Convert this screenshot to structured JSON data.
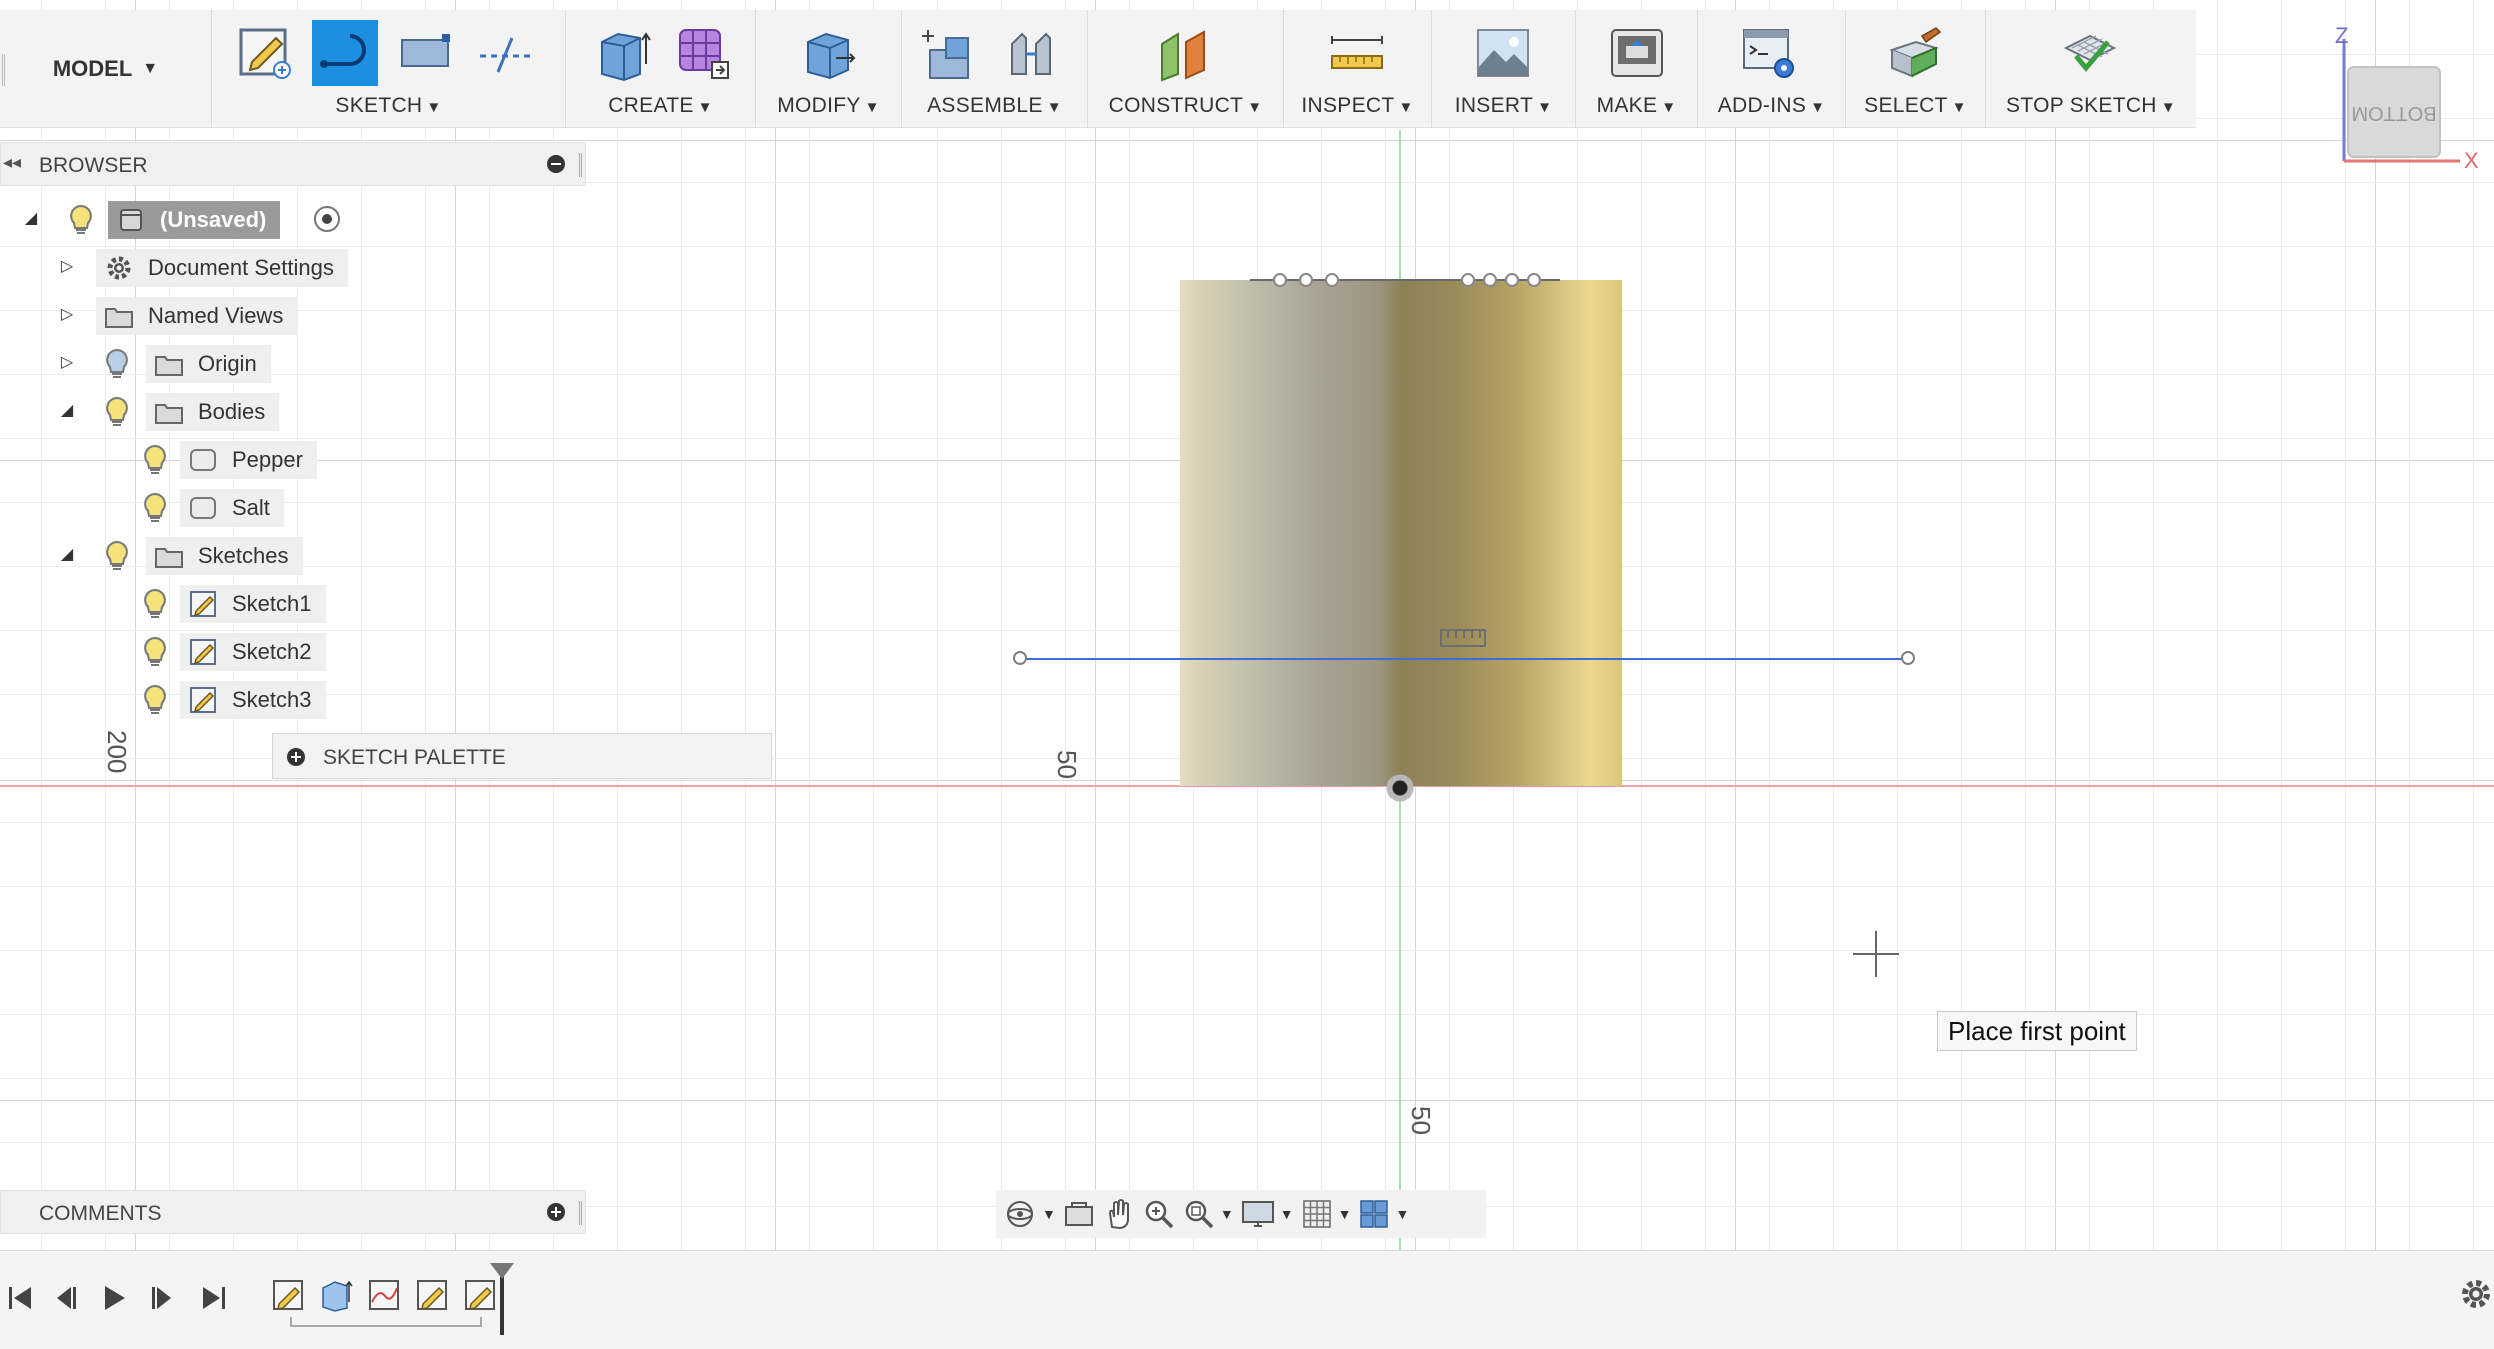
{
  "toolbar": {
    "model_label": "MODEL",
    "groups": [
      {
        "label": "SKETCH"
      },
      {
        "label": "CREATE"
      },
      {
        "label": "MODIFY"
      },
      {
        "label": "ASSEMBLE"
      },
      {
        "label": "CONSTRUCT"
      },
      {
        "label": "INSPECT"
      },
      {
        "label": "INSERT"
      },
      {
        "label": "MAKE"
      },
      {
        "label": "ADD-INS"
      },
      {
        "label": "SELECT"
      },
      {
        "label": "STOP SKETCH"
      }
    ]
  },
  "viewcube": {
    "face_label": "BOTTOM",
    "axis_z": "Z",
    "axis_x": "X"
  },
  "browser": {
    "title": "BROWSER",
    "root": "(Unsaved)",
    "items": [
      {
        "label": "Document Settings",
        "icon": "gear-icon"
      },
      {
        "label": "Named Views",
        "icon": "folder-icon"
      },
      {
        "label": "Origin",
        "icon": "folder-icon"
      },
      {
        "label": "Bodies",
        "icon": "folder-icon"
      },
      {
        "label": "Pepper",
        "icon": "body-icon"
      },
      {
        "label": "Salt",
        "icon": "body-icon"
      },
      {
        "label": "Sketches",
        "icon": "folder-icon"
      },
      {
        "label": "Sketch1",
        "icon": "sketch-icon"
      },
      {
        "label": "Sketch2",
        "icon": "sketch-icon"
      },
      {
        "label": "Sketch3",
        "icon": "sketch-icon"
      }
    ]
  },
  "sketch_palette": {
    "title": "SKETCH PALETTE"
  },
  "dimensions": {
    "left_label": "200",
    "center_label": "50",
    "bottom_label": "50"
  },
  "tooltip": {
    "text": "Place first point"
  },
  "comments": {
    "title": "COMMENTS"
  },
  "colors": {
    "accent": "#1d8fe0",
    "x_axis": "#f1a3a3",
    "y_axis": "#a8e2a8",
    "sketch_line": "#3d6ed6"
  }
}
